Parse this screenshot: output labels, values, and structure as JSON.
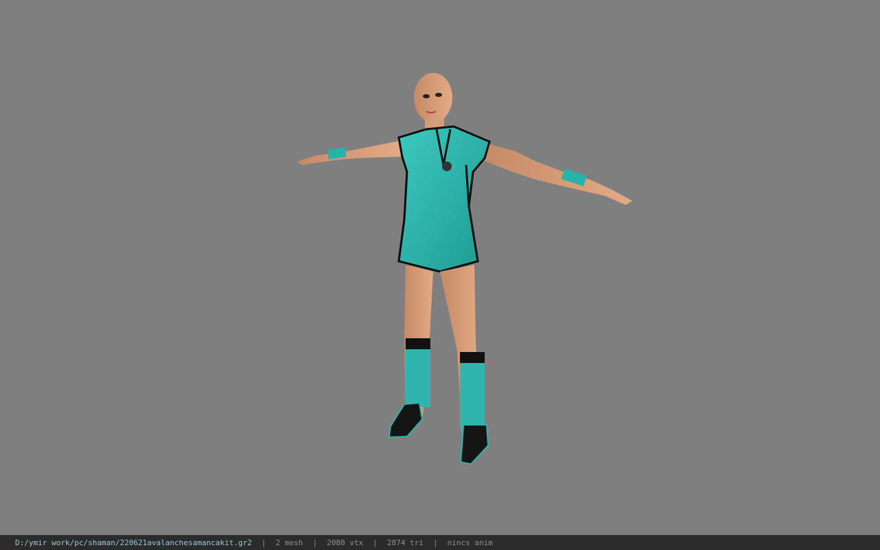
{
  "viewport": {
    "background": "#7f7f7f",
    "model_description": "textured 3D character in T-pose"
  },
  "status": {
    "file_path": "D:/ymir work/pc/shaman/220621avalanchesamancakit.gr2",
    "separator": "|",
    "mesh": "2 mesh",
    "vtx": "2080 vtx",
    "tri": "2874 tri",
    "anim": "nincs anim"
  },
  "colors": {
    "teal": "#2fb5ad",
    "teal_dark": "#1f8f89",
    "skin": "#d9a07a",
    "trim": "#111111",
    "status_bg": "#2b2b2b",
    "path_text": "#9ac8d8"
  }
}
